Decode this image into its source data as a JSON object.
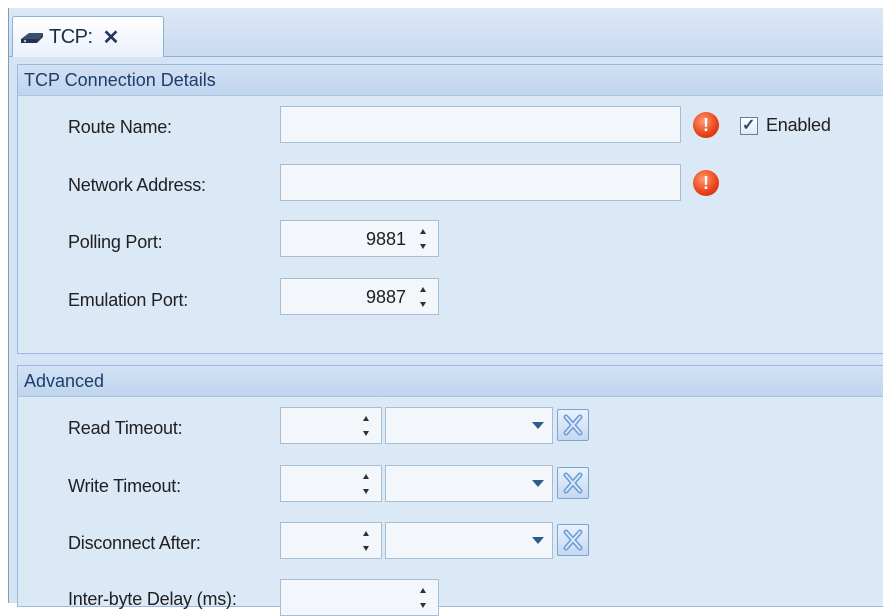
{
  "tab": {
    "label": "TCP:",
    "close_glyph": "✕",
    "icon": "network-device-icon"
  },
  "connection": {
    "header": "TCP Connection Details",
    "route_name": {
      "label": "Route Name:",
      "value": ""
    },
    "enabled": {
      "label": "Enabled",
      "checked": true
    },
    "network_address": {
      "label": "Network Address:",
      "value": ""
    },
    "polling_port": {
      "label": "Polling Port:",
      "value": "9881"
    },
    "emulation_port": {
      "label": "Emulation Port:",
      "value": "9887"
    },
    "error_icon": "error-exclamation-icon"
  },
  "advanced": {
    "header": "Advanced",
    "read_timeout": {
      "label": "Read Timeout:",
      "value": "",
      "unit": ""
    },
    "write_timeout": {
      "label": "Write Timeout:",
      "value": "",
      "unit": ""
    },
    "disconnect_after": {
      "label": "Disconnect After:",
      "value": "",
      "unit": ""
    },
    "inter_byte_delay": {
      "label": "Inter-byte Delay (ms):",
      "value": ""
    },
    "clear_icon": "clear-x-icon"
  },
  "colors": {
    "error": "#e8401a",
    "header_text": "#1d3d6b",
    "panel_bg": "#dbe8f6"
  }
}
